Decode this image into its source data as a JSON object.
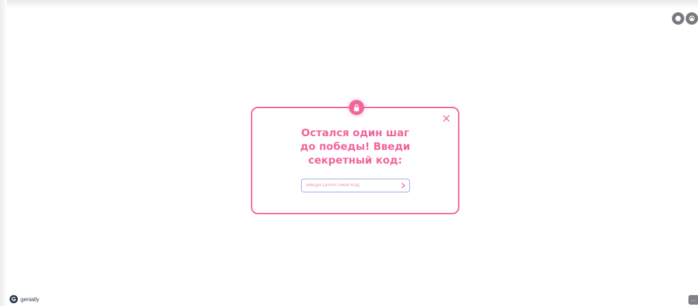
{
  "modal": {
    "title_lines": [
      "Остался один шаг",
      "до победы! Введи",
      "секретный код:"
    ],
    "input_placeholder": "ВВЕДИ СЕКРЕТНЫЙ КОД",
    "submit_icon": "chevron-right-icon",
    "close_icon": "close-icon",
    "badge_icon": "lock-icon"
  },
  "footer": {
    "brand_name": "genially",
    "more_label": "..."
  },
  "top_controls": [
    {
      "icon": "circle-icon"
    },
    {
      "icon": "eye-icon"
    }
  ],
  "colors": {
    "accent": "#f2649b",
    "input_border": "#9aa8e8",
    "control_gray": "#777a7f",
    "brand_dark": "#2d3a4a"
  }
}
